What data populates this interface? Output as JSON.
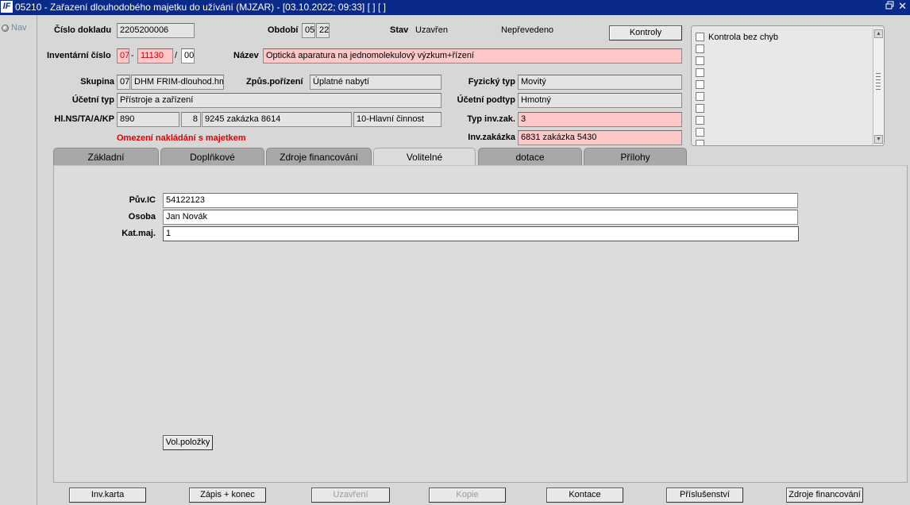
{
  "window": {
    "title": "05210 - Zařazení dlouhodobého majetku do užívání (MJZAR) - [03.10.2022; 09:33]  [ ]  [ ]",
    "logo": "IF",
    "restore_glyph": "🗗",
    "close_glyph": "✕"
  },
  "nav": {
    "label": "Nav"
  },
  "header": {
    "cislo_dokladu_label": "Číslo dokladu",
    "cislo_dokladu_value": "2205200006",
    "obdobi_label": "Období",
    "obdobi_month": "05",
    "obdobi_year": "22",
    "stav_label": "Stav",
    "stav_value": "Uzavřen",
    "prevod_status": "Nepřevedeno",
    "kontroly_button": "Kontroly",
    "inventarni_cislo_label": "Inventární číslo",
    "inv_part1": "07",
    "inv_sep1": "-",
    "inv_part2": "11130",
    "inv_sep2": "/",
    "inv_part3": "00",
    "nazev_label": "Název",
    "nazev_value": "Optická aparatura na jednomolekulový výzkum+řízení",
    "skupina_label": "Skupina",
    "skupina_code": "07",
    "skupina_name": "DHM FRIM-dlouhod.hmo",
    "zpusob_porizeni_label": "Způs.pořízení",
    "zpusob_porizeni_value": "Úplatné nabytí",
    "fyzicky_typ_label": "Fyzický typ",
    "fyzicky_typ_value": "Movitý",
    "ucetni_typ_label": "Účetní typ",
    "ucetni_typ_value": "Přístroje a zařízení",
    "ucetni_podtyp_label": "Účetní podtyp",
    "ucetni_podtyp_value": "Hmotný",
    "hlns_label": "Hl.NS/TA/A/KP",
    "hlns_value": "890",
    "ta_value": "8",
    "zakazka_value": "9245 zakázka 8614",
    "kp_value": "10-Hlavní činnost",
    "typ_inv_zak_label": "Typ inv.zak.",
    "typ_inv_zak_value": "3",
    "warning": "Omezení nakládání s majetkem",
    "inv_zakazka_label": "Inv.zakázka",
    "inv_zakazka_value": "6831 zakázka 5430"
  },
  "checks": {
    "items": [
      "Kontrola bez chyb",
      "",
      "",
      "",
      "",
      "",
      "",
      "",
      "",
      ""
    ]
  },
  "tabs": [
    {
      "label": "Základní"
    },
    {
      "label": "Doplňkové"
    },
    {
      "label": "Zdroje financování"
    },
    {
      "label": "Volitelné"
    },
    {
      "label": "dotace"
    },
    {
      "label": "Přílohy"
    }
  ],
  "volitelne": {
    "puv_ic_label": "Pův.IC",
    "puv_ic_value": "54122123",
    "osoba_label": "Osoba",
    "osoba_value": "Jan Novák",
    "kat_maj_label": "Kat.maj.",
    "kat_maj_value": "1",
    "vol_polozky_button": "Vol.položky"
  },
  "footer_buttons": [
    {
      "label": "Inv.karta",
      "enabled": true
    },
    {
      "label": "Zápis + konec",
      "enabled": true
    },
    {
      "label": "Uzavření",
      "enabled": false
    },
    {
      "label": "Kopie",
      "enabled": false
    },
    {
      "label": "Kontace",
      "enabled": true
    },
    {
      "label": "Příslušenství",
      "enabled": true
    },
    {
      "label": "Zdroje financování",
      "enabled": true
    }
  ]
}
